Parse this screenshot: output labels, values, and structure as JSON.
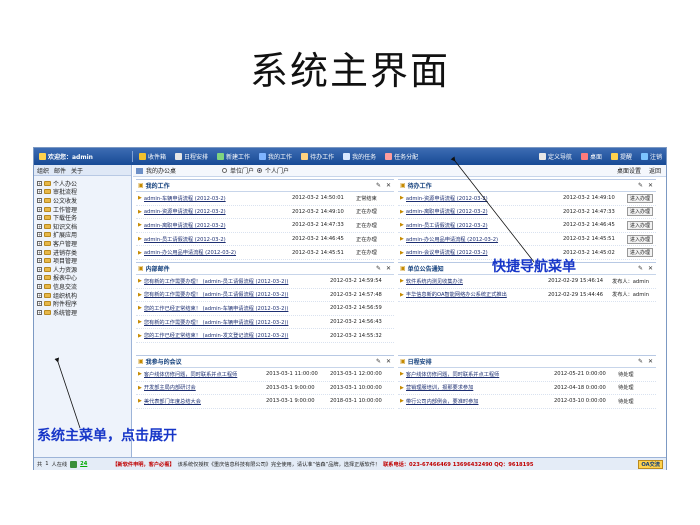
{
  "slide_title": "系统主界面",
  "topbar": {
    "welcome": "欢迎您：admin",
    "items": [
      {
        "label": "收件箱",
        "icon": "inbox-icon",
        "color": "#f2c12e"
      },
      {
        "label": "日程安排",
        "icon": "calendar-icon",
        "color": "#e6e6e6"
      },
      {
        "label": "新建工作",
        "icon": "new-work-icon",
        "color": "#7fd47f"
      },
      {
        "label": "我的工作",
        "icon": "my-work-icon",
        "color": "#7fb4ff"
      },
      {
        "label": "待办工作",
        "icon": "todo-icon",
        "color": "#ffd27f"
      },
      {
        "label": "我的任务",
        "icon": "task-icon",
        "color": "#d9e8ff"
      },
      {
        "label": "任务分配",
        "icon": "assign-icon",
        "color": "#ff9d9d"
      }
    ],
    "right_items": [
      {
        "label": "定义导航",
        "icon": "nav-define-icon",
        "color": "#e8e8e8"
      },
      {
        "label": "桌面",
        "icon": "desktop-icon",
        "color": "#ff7b7b"
      },
      {
        "label": "提醒",
        "icon": "bell-icon",
        "color": "#ffd24d"
      },
      {
        "label": "注销",
        "icon": "logout-icon",
        "color": "#7cc4ff"
      }
    ]
  },
  "sidebar": {
    "tabs": [
      "组织",
      "邮件",
      "关于"
    ],
    "items": [
      "个人办公",
      "审批流程",
      "公文收发",
      "工作管理",
      "下载任务",
      "知识文档",
      "扩展应用",
      "客户管理",
      "进销存类",
      "项目管理",
      "人力资源",
      "报表中心",
      "信息交流",
      "组织机构",
      "附件程序",
      "系统管理"
    ]
  },
  "main": {
    "tab_label": "我的办公桌",
    "radio_unit": "单位门户",
    "radio_personal": "个人门户",
    "desktop_settings": "桌面设置",
    "back": "返回"
  },
  "panels": {
    "my_work": {
      "title": "我的工作",
      "rows": [
        {
          "text": "admin-车辆申请流程 (2012-03-2)",
          "time": "2012-03-2 14:50:01",
          "status": "正常结束"
        },
        {
          "text": "admin-资源申请流程 (2012-03-2)",
          "time": "2012-03-2 14:49:10",
          "status": "正在办理"
        },
        {
          "text": "admin-离职申请流程 (2012-03-2)",
          "time": "2012-03-2 14:47:33",
          "status": "正在办理"
        },
        {
          "text": "admin-员工请假流程 (2012-03-2)",
          "time": "2012-03-2 14:46:45",
          "status": "正在办理"
        },
        {
          "text": "admin-办公用品申请流程 (2012-03-2)",
          "time": "2012-03-2 14:45:51",
          "status": "正在办理"
        }
      ]
    },
    "todo_work": {
      "title": "待办工作",
      "btn": "进入办理",
      "rows": [
        {
          "text": "admin-资源申请流程 (2012-03-2)",
          "time": "2012-03-2 14:49:10"
        },
        {
          "text": "admin-离职申请流程 (2012-03-2)",
          "time": "2012-03-2 14:47:33"
        },
        {
          "text": "admin-员工请假流程 (2012-03-2)",
          "time": "2012-03-2 14:46:45"
        },
        {
          "text": "admin-办公用品申请流程 (2012-03-2)",
          "time": "2012-03-2 14:45:51"
        },
        {
          "text": "admin-会议申请流程 (2012-03-2)",
          "time": "2012-03-2 14:45:02"
        }
      ]
    },
    "internal_mail": {
      "title": "内部邮件",
      "rows": [
        {
          "text": "您有新的工作需要办理！ (admin-员工请假流程 (2012-03-2))",
          "time": "2012-03-2 14:59:54"
        },
        {
          "text": "您有新的工作需要办理！ (admin-员工请假流程 (2012-03-2))",
          "time": "2012-03-2 14:57:48"
        },
        {
          "text": "您的工作已经正常结束！ (admin-车辆申请流程 (2012-03-2))",
          "time": "2012-03-2 14:56:59"
        },
        {
          "text": "您有新的工作需要办理！ (admin-车辆申请流程 (2012-03-2))",
          "time": "2012-03-2 14:56:43"
        },
        {
          "text": "您的工作已经正常结束！ (admin-发文登记流程 (2012-03-2))",
          "time": "2012-03-2 14:55:32"
        }
      ]
    },
    "notice": {
      "title": "单位公告通知",
      "rows": [
        {
          "text": "软件系统内测见收集办法",
          "time": "2012-02-29 15:46:14",
          "pub": "发布人：admin"
        },
        {
          "text": "丰华信息新的OA智能网络办公系统正式推出",
          "time": "2012-02-29 15:44:46",
          "pub": "发布人：admin"
        }
      ]
    },
    "meetings": {
      "title": "我参与的会议",
      "rows": [
        {
          "text": "客户线体仿修问题，同时联系并点工程师",
          "start": "2013-03-1 11:00:00",
          "end": "2013-03-1 12:00:00"
        },
        {
          "text": "开发部主局内部研讨会",
          "start": "2013-03-1 9:00:00",
          "end": "2013-03-1 10:00:00"
        },
        {
          "text": "美代表部门年度总结大会",
          "start": "2013-03-1 9:00:00",
          "end": "2018-03-1 10:00:00"
        }
      ]
    },
    "schedule": {
      "title": "日程安排",
      "rows": [
        {
          "text": "客户线体仿修问题，同时联系并点工程师",
          "time": "2012-05-21 0:00:00",
          "status": "待处理"
        },
        {
          "text": "营销理服培训，报那要求参加",
          "time": "2012-04-18 0:00:00",
          "status": "待处理"
        },
        {
          "text": "带行公司内部例会，要准时参加",
          "time": "2012-03-10 0:00:00",
          "status": "待处理"
        }
      ]
    }
  },
  "statusbar": {
    "online_prefix": "共",
    "online_count": "1",
    "online_suffix": "人在线",
    "online_num2": "24",
    "promo": "【新软件申明，客户必看】",
    "copyright": "该系统仅授权《重庆信息科技有限公司》完全使用，请认准“信森”品牌，选择正版软件！",
    "hotline": "联系电话：023-67466469  13696432490  QQ：9618195",
    "logo": "OA交流"
  },
  "annotations": {
    "quick_nav": "快捷导航菜单",
    "main_menu": "系统主菜单，点击展开"
  }
}
